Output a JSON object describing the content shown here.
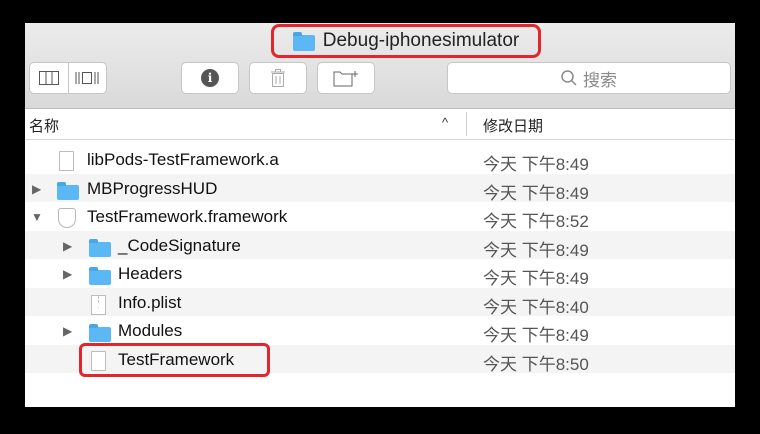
{
  "window": {
    "title": "Debug-iphonesimulator"
  },
  "toolbar": {
    "view_buttons": [
      "column-view",
      "coverflow-view"
    ],
    "info_icon": "info-icon",
    "trash_icon": "trash-icon",
    "new_folder_icon": "new-folder-icon",
    "search_placeholder": "搜索"
  },
  "header": {
    "name": "名称",
    "sort_indicator": "^",
    "date_modified": "修改日期"
  },
  "files": [
    {
      "name": "libPods-TestFramework.a",
      "date": "今天 下午8:49",
      "type": "document",
      "expander": "none",
      "indent": 0
    },
    {
      "name": "MBProgressHUD",
      "date": "今天 下午8:49",
      "type": "folder",
      "expander": "collapsed",
      "indent": 0
    },
    {
      "name": "TestFramework.framework",
      "date": "今天 下午8:52",
      "type": "framework",
      "expander": "expanded",
      "indent": 0
    },
    {
      "name": "_CodeSignature",
      "date": "今天 下午8:49",
      "type": "folder",
      "expander": "collapsed",
      "indent": 1
    },
    {
      "name": "Headers",
      "date": "今天 下午8:49",
      "type": "folder",
      "expander": "collapsed",
      "indent": 1
    },
    {
      "name": "Info.plist",
      "date": "今天 下午8:40",
      "type": "plist",
      "expander": "none",
      "indent": 1
    },
    {
      "name": "Modules",
      "date": "今天 下午8:49",
      "type": "folder",
      "expander": "collapsed",
      "indent": 1
    },
    {
      "name": "TestFramework",
      "date": "今天 下午8:50",
      "type": "document",
      "expander": "none",
      "indent": 1
    }
  ],
  "colors": {
    "highlight": "#e3262b",
    "folder": "#5cb8f4"
  }
}
